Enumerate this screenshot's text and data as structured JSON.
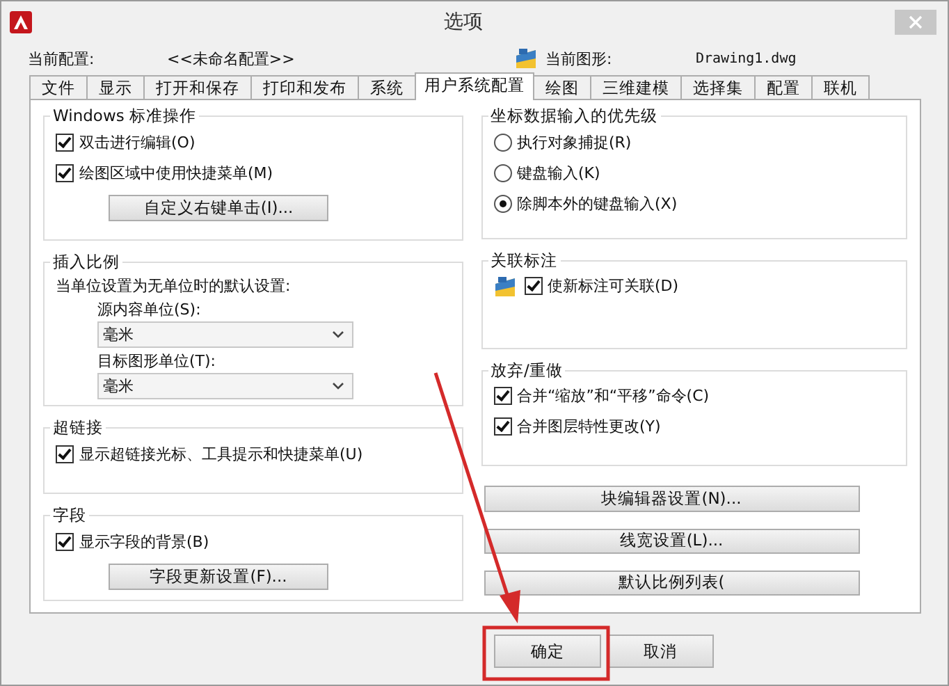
{
  "window": {
    "title": "选项"
  },
  "profile": {
    "label": "当前配置:",
    "value": "<<未命名配置>>"
  },
  "drawing": {
    "label": "当前图形:",
    "value": "Drawing1.dwg"
  },
  "tabs": [
    {
      "label": "文件",
      "selected": false
    },
    {
      "label": "显示",
      "selected": false
    },
    {
      "label": "打开和保存",
      "selected": false
    },
    {
      "label": "打印和发布",
      "selected": false
    },
    {
      "label": "系统",
      "selected": false
    },
    {
      "label": "用户系统配置",
      "selected": true
    },
    {
      "label": "绘图",
      "selected": false
    },
    {
      "label": "三维建模",
      "selected": false
    },
    {
      "label": "选择集",
      "selected": false
    },
    {
      "label": "配置",
      "selected": false
    },
    {
      "label": "联机",
      "selected": false
    }
  ],
  "left_groups": [
    {
      "title": "Windows 标准操作",
      "items": [
        {
          "kind": "checkbox",
          "label": "双击进行编辑(O)",
          "checked": true
        },
        {
          "kind": "checkbox",
          "label": "绘图区域中使用快捷菜单(M)",
          "checked": true
        },
        {
          "kind": "button",
          "label": "自定义右键单击(I)..."
        }
      ]
    },
    {
      "title": "插入比例",
      "items": [
        {
          "kind": "note",
          "label": "当单位设置为无单位时的默认设置:"
        },
        {
          "kind": "field_label",
          "label": "源内容单位(S):"
        },
        {
          "kind": "dropdown",
          "label": "毫米"
        },
        {
          "kind": "field_label",
          "label": "目标图形单位(T):"
        },
        {
          "kind": "dropdown",
          "label": "毫米"
        }
      ]
    },
    {
      "title": "超链接",
      "items": [
        {
          "kind": "checkbox",
          "label": "显示超链接光标、工具提示和快捷菜单(U)",
          "checked": true
        }
      ]
    },
    {
      "title": "字段",
      "items": [
        {
          "kind": "checkbox",
          "label": "显示字段的背景(B)",
          "checked": true
        },
        {
          "kind": "button",
          "label": "字段更新设置(F)..."
        }
      ]
    }
  ],
  "right_groups": [
    {
      "title": "坐标数据输入的优先级",
      "items": [
        {
          "kind": "radio",
          "label": "执行对象捕捉(R)",
          "selected": false
        },
        {
          "kind": "radio",
          "label": "键盘输入(K)",
          "selected": false
        },
        {
          "kind": "radio",
          "label": "除脚本外的键盘输入(X)",
          "selected": true
        }
      ]
    },
    {
      "title": "关联标注",
      "items": [
        {
          "kind": "icon_checkbox",
          "label": "使新标注可关联(D)",
          "checked": true
        }
      ]
    },
    {
      "title": "放弃/重做",
      "items": [
        {
          "kind": "checkbox",
          "label": "合并“缩放”和“平移”命令(C)",
          "checked": true
        },
        {
          "kind": "checkbox",
          "label": "合并图层特性更改(Y)",
          "checked": true
        }
      ]
    }
  ],
  "right_buttons": [
    "块编辑器设置(N)...",
    "线宽设置(L)...",
    "默认比例列表("
  ],
  "buttons": [
    "确定",
    "取消"
  ],
  "annotations": {
    "arrow": true,
    "highlight_box": true
  }
}
